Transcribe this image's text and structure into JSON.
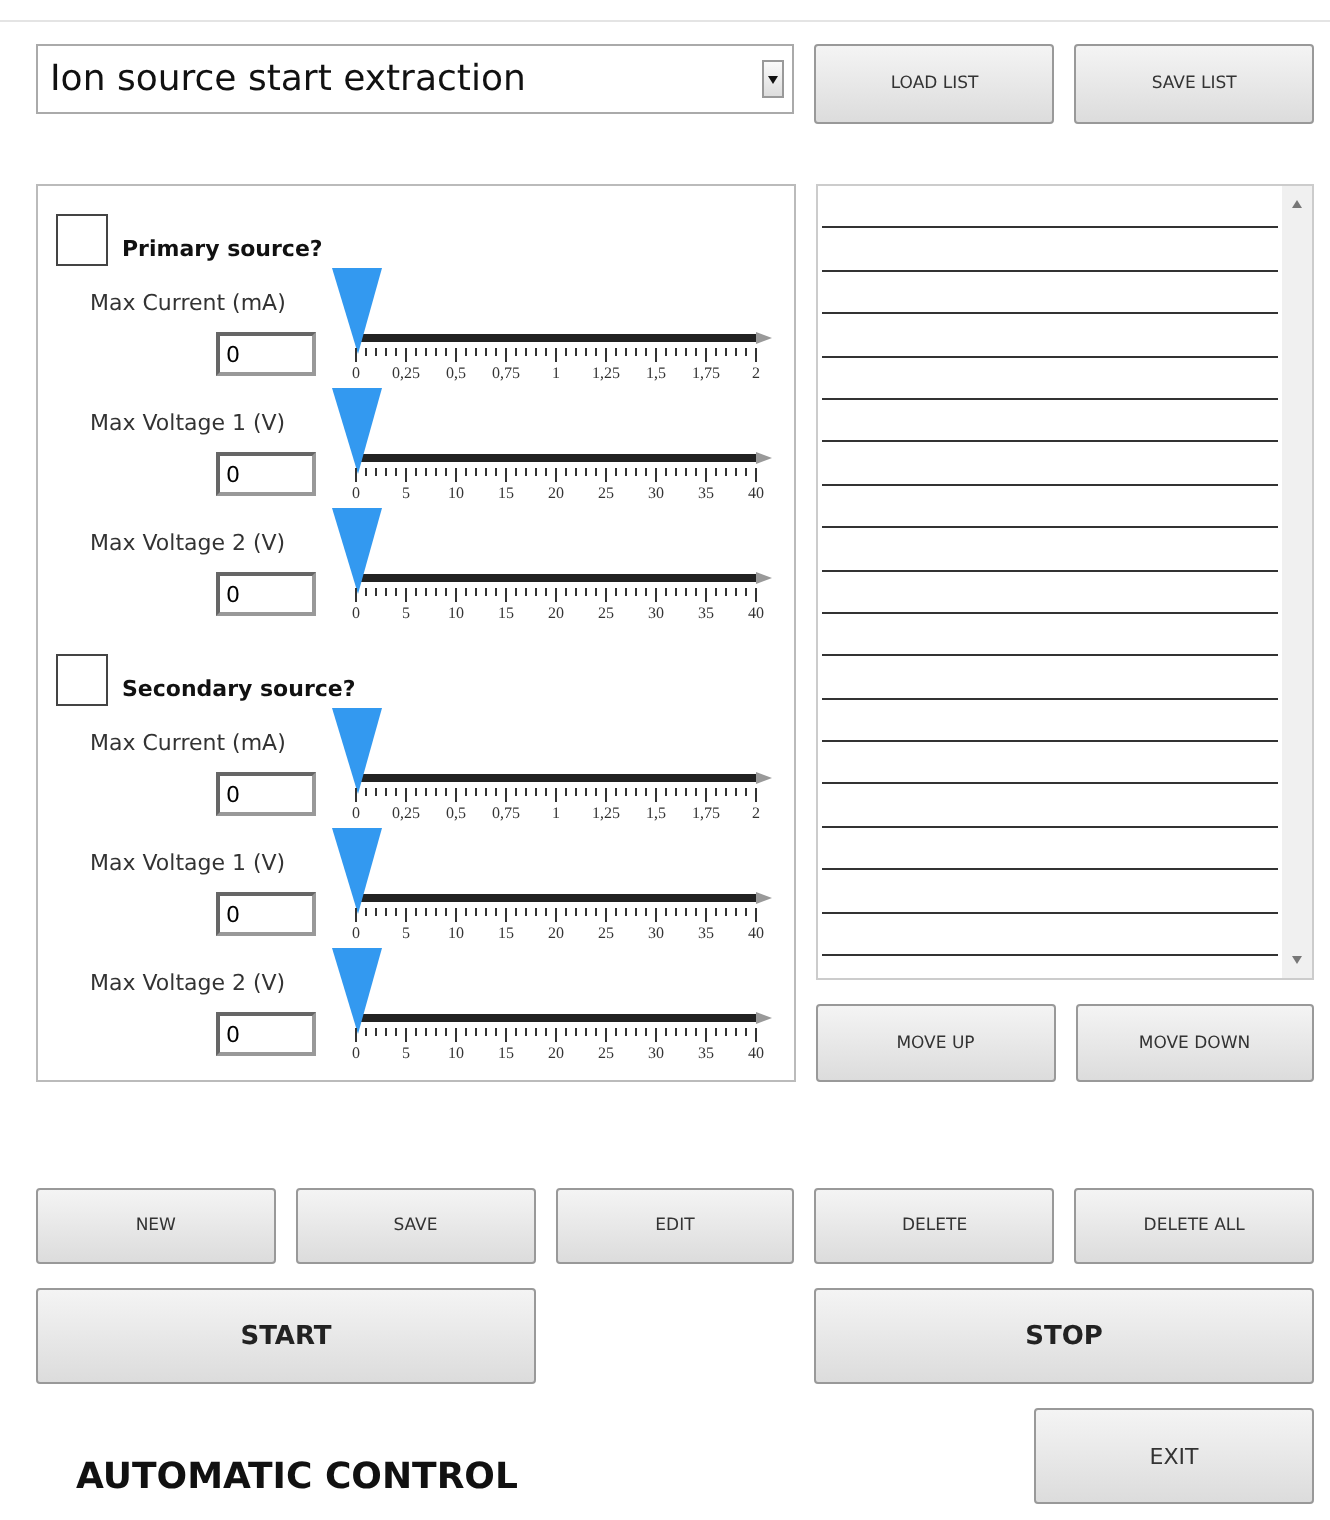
{
  "sequence_dropdown": {
    "value": "Ion source start extraction"
  },
  "top_buttons": [
    "LOAD LIST",
    "SAVE LIST"
  ],
  "sources": [
    {
      "label": "Primary source?",
      "checked": false,
      "sliders": [
        {
          "label": "Max Current (mA)",
          "value": "0",
          "level": 0,
          "ticks": [
            "0",
            "0,25",
            "0,5",
            "0,75",
            "1",
            "1,25",
            "1,5",
            "1,75",
            "2"
          ]
        },
        {
          "label": "Max Voltage 1 (V)",
          "value": "0",
          "level": 0,
          "ticks": [
            "0",
            "5",
            "10",
            "15",
            "20",
            "25",
            "30",
            "35",
            "40"
          ]
        },
        {
          "label": "Max Voltage 2 (V)",
          "value": "0",
          "level": 0,
          "ticks": [
            "0",
            "5",
            "10",
            "15",
            "20",
            "25",
            "30",
            "35",
            "40"
          ]
        }
      ]
    },
    {
      "label": "Secondary source?",
      "checked": false,
      "sliders": [
        {
          "label": "Max Current (mA)",
          "value": "0",
          "level": 0,
          "ticks": [
            "0",
            "0,25",
            "0,5",
            "0,75",
            "1",
            "1,25",
            "1,5",
            "1,75",
            "2"
          ]
        },
        {
          "label": "Max Voltage 1 (V)",
          "value": "0",
          "level": 0,
          "ticks": [
            "0",
            "5",
            "10",
            "15",
            "20",
            "25",
            "30",
            "35",
            "40"
          ]
        },
        {
          "label": "Max Voltage 2 (V)",
          "value": "0",
          "level": 0,
          "ticks": [
            "0",
            "5",
            "10",
            "15",
            "20",
            "25",
            "30",
            "35",
            "40"
          ]
        }
      ]
    }
  ],
  "list_buttons": [
    "MOVE UP",
    "MOVE DOWN"
  ],
  "edit_buttons": [
    "NEW",
    "SAVE",
    "EDIT",
    "DELETE",
    "DELETE ALL"
  ],
  "run_buttons": [
    "START",
    "STOP"
  ],
  "title": "AUTOMATIC CONTROL",
  "exit_button": "EXIT"
}
